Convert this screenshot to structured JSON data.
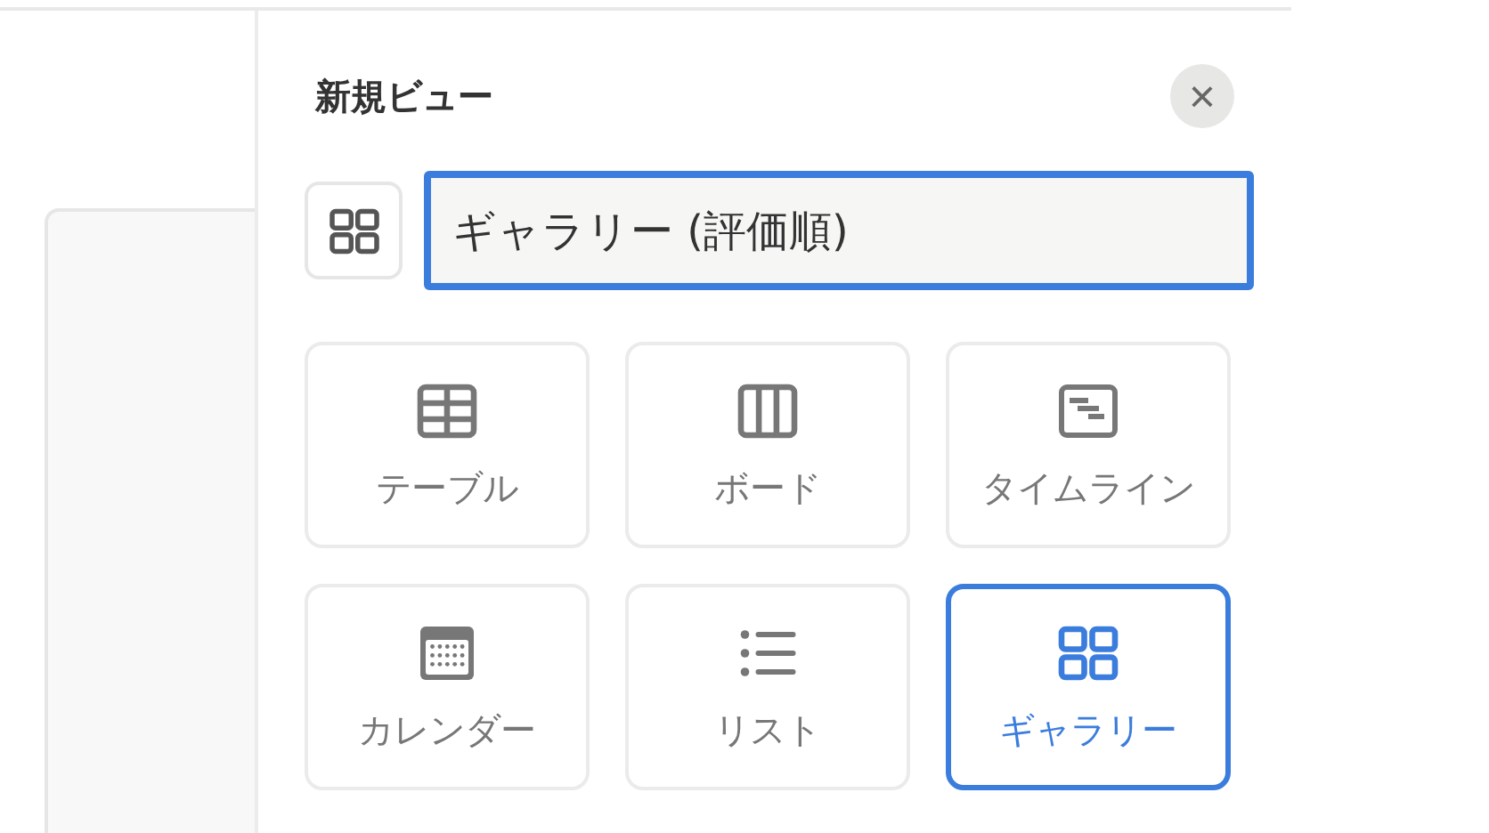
{
  "panel": {
    "title": "新規ビュー",
    "close": {
      "label": "×"
    }
  },
  "name_field": {
    "value": "ギャラリー (評価順)",
    "focused": true
  },
  "view_types": [
    {
      "kind": "table",
      "label": "テーブル",
      "selected": false
    },
    {
      "kind": "board",
      "label": "ボード",
      "selected": false
    },
    {
      "kind": "timeline",
      "label": "タイムライン",
      "selected": false
    },
    {
      "kind": "calendar",
      "label": "カレンダー",
      "selected": false
    },
    {
      "kind": "list",
      "label": "リスト",
      "selected": false
    },
    {
      "kind": "gallery",
      "label": "ギャラリー",
      "selected": true
    }
  ]
}
